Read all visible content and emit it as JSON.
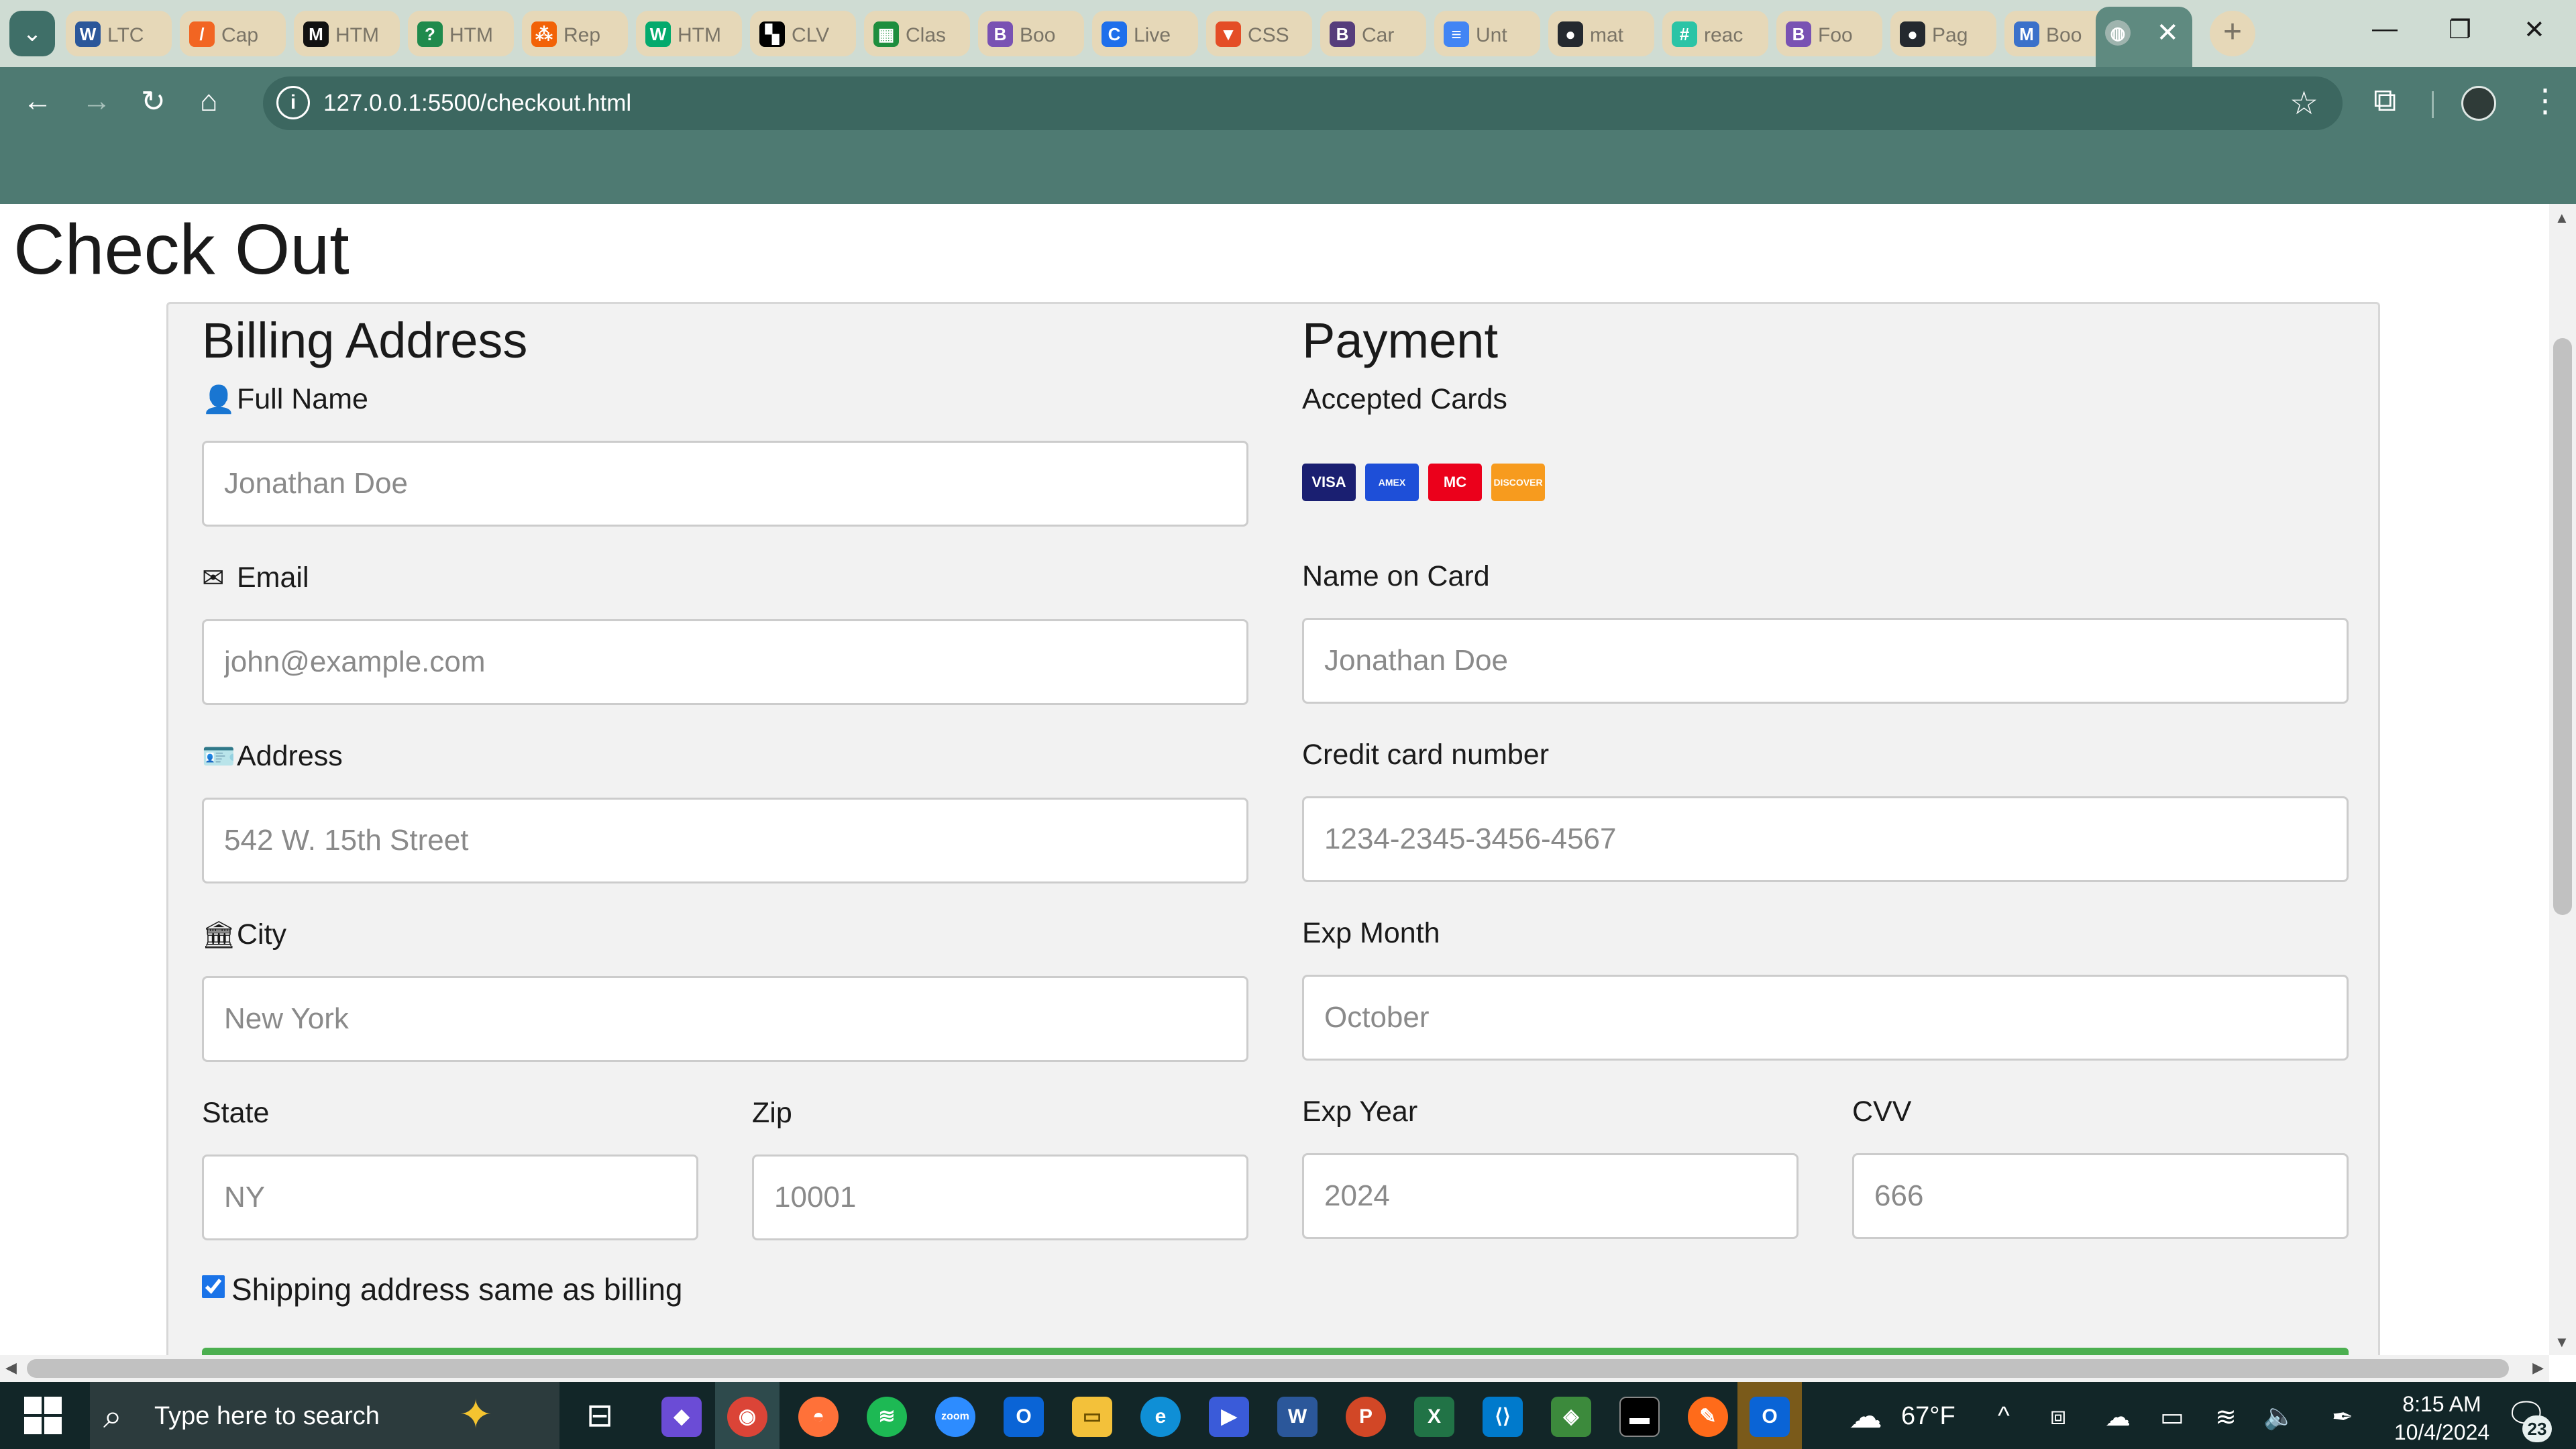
{
  "browser": {
    "tabs": [
      {
        "title": "LTC",
        "icon": "word-icon",
        "color": "#2b579a",
        "glyph": "W"
      },
      {
        "title": "Cap",
        "icon": "orange-logo-icon",
        "color": "#f26522",
        "glyph": "/"
      },
      {
        "title": "HTM",
        "icon": "m-logo-icon",
        "color": "#111111",
        "glyph": "M"
      },
      {
        "title": "HTM",
        "icon": "question-icon",
        "color": "#1f8a4c",
        "glyph": "?"
      },
      {
        "title": "Rep",
        "icon": "replit-icon",
        "color": "#f26207",
        "glyph": "⁂"
      },
      {
        "title": "HTM",
        "icon": "w3schools-icon",
        "color": "#04aa6d",
        "glyph": "W"
      },
      {
        "title": "CLV",
        "icon": "clv-icon",
        "color": "#000000",
        "glyph": "▚"
      },
      {
        "title": "Clas",
        "icon": "classroom-icon",
        "color": "#1e8e3e",
        "glyph": "▦"
      },
      {
        "title": "Boo",
        "icon": "bootstrap-icon",
        "color": "#7952b3",
        "glyph": "B"
      },
      {
        "title": "Live",
        "icon": "live-icon",
        "color": "#1f6feb",
        "glyph": "C"
      },
      {
        "title": "CSS",
        "icon": "css-icon",
        "color": "#e44d26",
        "glyph": "▼"
      },
      {
        "title": "Car",
        "icon": "bootstrap-icon",
        "color": "#563d7c",
        "glyph": "B"
      },
      {
        "title": "Unt",
        "icon": "docs-icon",
        "color": "#4285f4",
        "glyph": "≡"
      },
      {
        "title": "mat",
        "icon": "github-icon",
        "color": "#24292f",
        "glyph": "●"
      },
      {
        "title": "reac",
        "icon": "hash-icon",
        "color": "#2bc4a6",
        "glyph": "#"
      },
      {
        "title": "Foo",
        "icon": "bootstrap-icon",
        "color": "#7952b3",
        "glyph": "B"
      },
      {
        "title": "Pag",
        "icon": "github-icon",
        "color": "#24292f",
        "glyph": "●"
      },
      {
        "title": "Boo",
        "icon": "mdb-icon",
        "color": "#3b71ca",
        "glyph": "M"
      }
    ],
    "active_tab_close": "✕",
    "new_tab": "+",
    "url": "127.0.0.1:5500/checkout.html"
  },
  "page": {
    "title": "Check Out",
    "billing": {
      "heading": "Billing Address",
      "full_name_label": "Full Name",
      "full_name_placeholder": "Jonathan Doe",
      "email_label": "Email",
      "email_placeholder": "john@example.com",
      "address_label": "Address",
      "address_placeholder": "542 W. 15th Street",
      "city_label": "City",
      "city_placeholder": "New York",
      "state_label": "State",
      "state_placeholder": "NY",
      "zip_label": "Zip",
      "zip_placeholder": "10001"
    },
    "payment": {
      "heading": "Payment",
      "accepted_cards_label": "Accepted Cards",
      "cards": [
        {
          "name": "VISA",
          "color": "#1a1f71"
        },
        {
          "name": "AMEX",
          "color": "#1e4fd8"
        },
        {
          "name": "MC",
          "color": "#eb001b"
        },
        {
          "name": "DISCOVER",
          "color": "#f79b1e"
        }
      ],
      "name_on_card_label": "Name on Card",
      "name_on_card_placeholder": "Jonathan Doe",
      "card_number_label": "Credit card number",
      "card_number_placeholder": "1234-2345-3456-4567",
      "exp_month_label": "Exp Month",
      "exp_month_placeholder": "October",
      "exp_year_label": "Exp Year",
      "exp_year_placeholder": "2024",
      "cvv_label": "CVV",
      "cvv_placeholder": "666"
    },
    "same_address_label": "Shipping address same as billing",
    "same_address_checked": true
  },
  "taskbar": {
    "search_placeholder": "Type here to search",
    "weather": "67°F",
    "time": "8:15 AM",
    "date": "10/4/2024",
    "notifications": "23"
  }
}
